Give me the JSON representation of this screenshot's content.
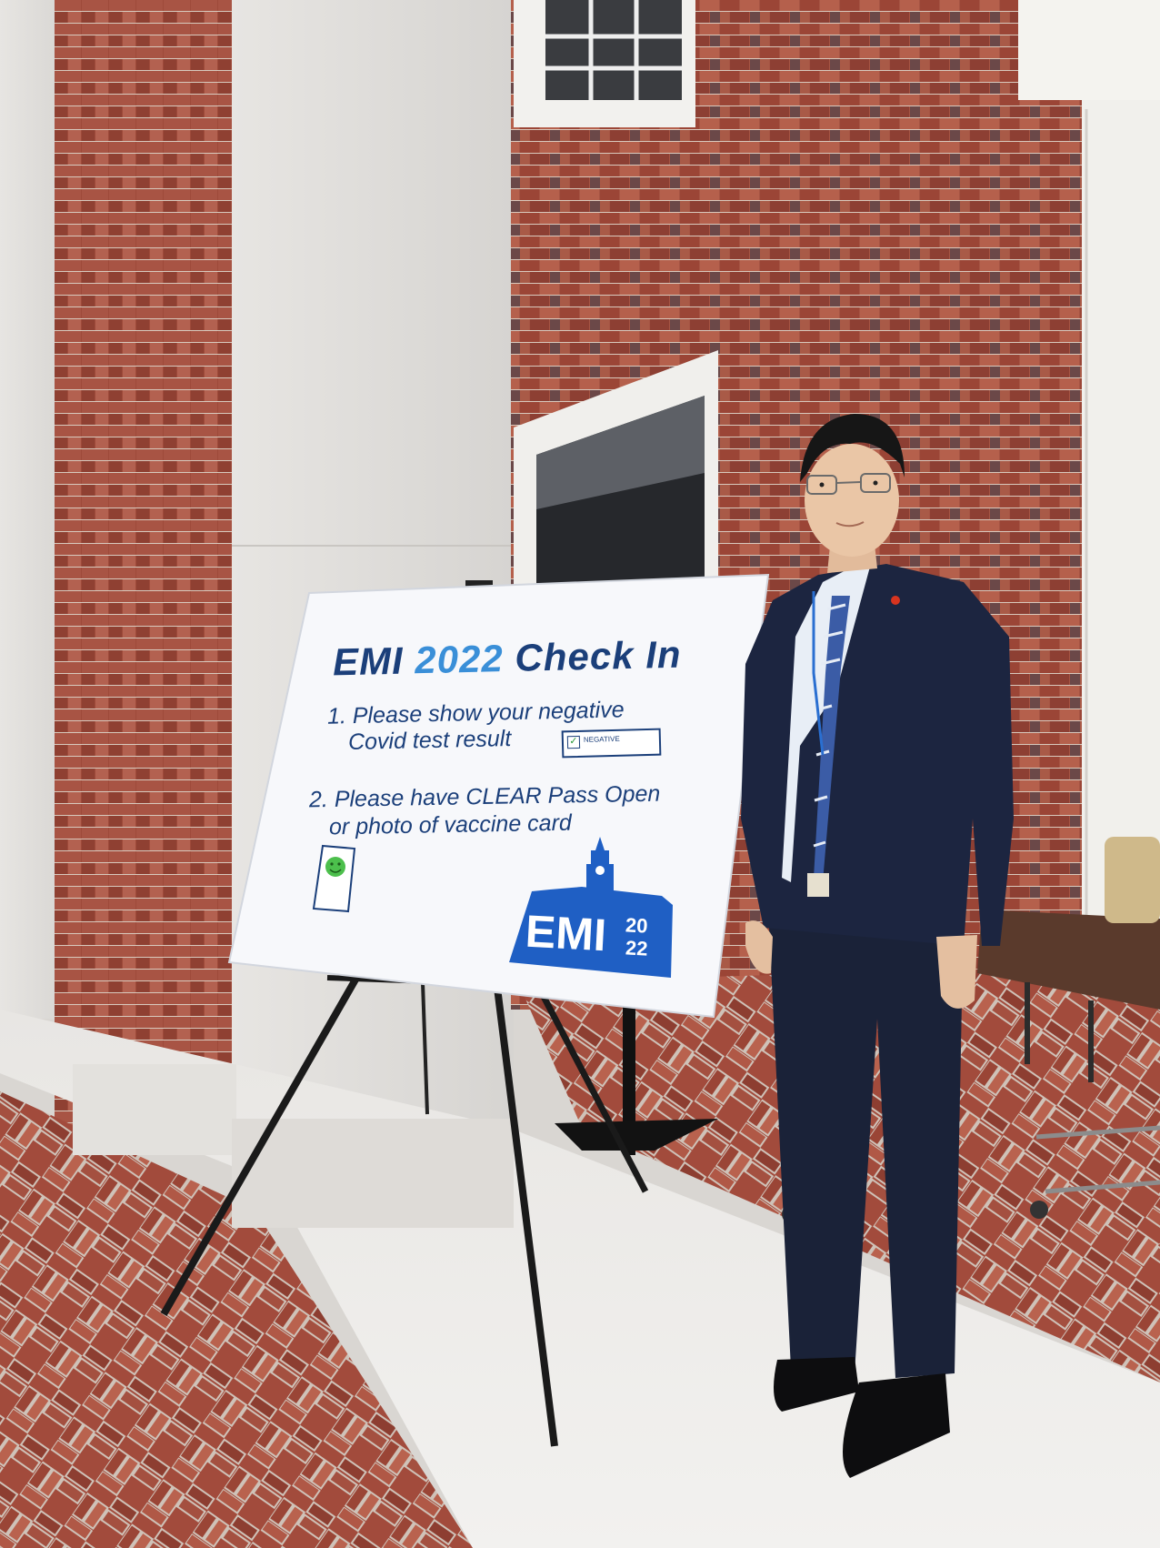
{
  "sign": {
    "title_prefix": "EMI ",
    "title_year": "2022",
    "title_suffix": " Check In",
    "step1_line1": "1.  Please show your negative",
    "step1_line2": "Covid test result",
    "negative_label": "NEGATIVE",
    "step2_line1": "2.  Please have CLEAR Pass Open",
    "step2_line2": "or photo of vaccine card",
    "logo_word": "EMI",
    "logo_year_top": "20",
    "logo_year_bottom": "22"
  },
  "colors": {
    "sign_navy": "#1b3f7a",
    "sign_accent_blue": "#3a8fd8",
    "logo_blue": "#1f5fc4",
    "brick": "#9b4a3a",
    "suit": "#1a2238"
  },
  "icons": [
    "smiley-phone-icon",
    "clock-tower-logo"
  ]
}
